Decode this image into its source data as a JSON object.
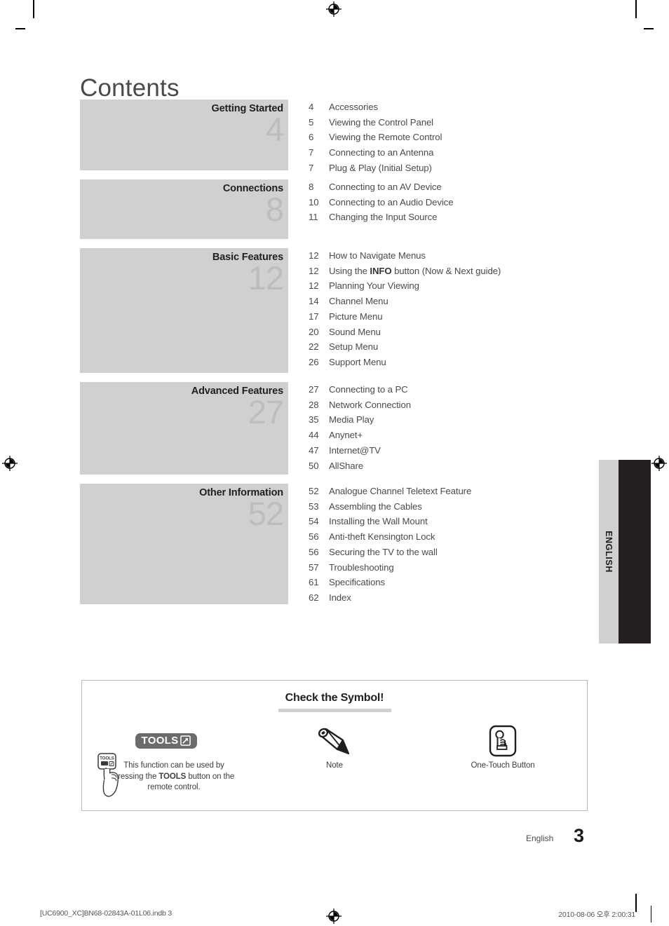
{
  "page": {
    "title": "Contents",
    "language_tab": "ENGLISH",
    "footer_language": "English",
    "footer_page_number": "3",
    "imprint_left": "[UC6900_XC]BN68-02843A-01L06.indb   3",
    "imprint_right": "2010-08-06   오후 2:00:31"
  },
  "colors": {
    "section_block_bg": "#cfd1d0",
    "section_number": "#bcbebd",
    "tab_bg": "#cfd1d0",
    "tab_black": "#231f20",
    "tools_badge_bg": "#6b6b6b",
    "body_text": "#4b4b4b",
    "title_text": "#1f1f1f"
  },
  "toc": {
    "sections": [
      {
        "title": "Getting Started",
        "number": "4",
        "block_height": 101,
        "entries": [
          {
            "page": "4",
            "name": "Accessories"
          },
          {
            "page": "5",
            "name": "Viewing the Control Panel"
          },
          {
            "page": "6",
            "name": "Viewing the Remote Control"
          },
          {
            "page": "7",
            "name": "Connecting to an Antenna"
          },
          {
            "page": "7",
            "name": "Plug & Play (Initial Setup)"
          }
        ]
      },
      {
        "title": "Connections",
        "number": "8",
        "block_height": 85,
        "entries": [
          {
            "page": "8",
            "name": "Connecting to an AV Device"
          },
          {
            "page": "10",
            "name": "Connecting to an Audio Device"
          },
          {
            "page": "11",
            "name": "Changing the Input Source"
          }
        ]
      },
      {
        "title": "Basic Features",
        "number": "12",
        "block_height": 178,
        "entries": [
          {
            "page": "12",
            "name": "How to Navigate Menus"
          },
          {
            "page": "12",
            "name_pre": "Using the ",
            "name_bold": "INFO",
            "name_post": " button (Now & Next guide)"
          },
          {
            "page": "12",
            "name": "Planning Your Viewing"
          },
          {
            "page": "14",
            "name": "Channel Menu"
          },
          {
            "page": "17",
            "name": "Picture Menu"
          },
          {
            "page": "20",
            "name": "Sound Menu"
          },
          {
            "page": "22",
            "name": "Setup Menu"
          },
          {
            "page": "26",
            "name": "Support Menu"
          }
        ]
      },
      {
        "title": "Advanced Features",
        "number": "27",
        "block_height": 132,
        "entries": [
          {
            "page": "27",
            "name": "Connecting to a PC"
          },
          {
            "page": "28",
            "name": "Network Connection"
          },
          {
            "page": "35",
            "name": "Media Play"
          },
          {
            "page": "44",
            "name": "Anynet+"
          },
          {
            "page": "47",
            "name": "Internet@TV"
          },
          {
            "page": "50",
            "name": "AllShare"
          }
        ]
      },
      {
        "title": "Other Information",
        "number": "52",
        "block_height": 172,
        "entries": [
          {
            "page": "52",
            "name": "Analogue Channel Teletext Feature"
          },
          {
            "page": "53",
            "name": "Assembling the Cables"
          },
          {
            "page": "54",
            "name": "Installing the Wall Mount"
          },
          {
            "page": "56",
            "name": "Anti-theft Kensington Lock"
          },
          {
            "page": "56",
            "name": "Securing the TV to the wall"
          },
          {
            "page": "57",
            "name": "Troubleshooting"
          },
          {
            "page": "61",
            "name": "Specifications"
          },
          {
            "page": "62",
            "name": "Index"
          }
        ]
      }
    ]
  },
  "symbol_box": {
    "title": "Check the Symbol!",
    "items": [
      {
        "icon": "tools-badge-icon",
        "badge_label": "TOOLS",
        "caption_line1": "This function can be used by",
        "caption_pre": "pressing the ",
        "caption_bold": "TOOLS",
        "caption_post": " button on the",
        "caption_line3": "remote control."
      },
      {
        "icon": "pencil-icon",
        "caption": "Note"
      },
      {
        "icon": "one-touch-button-icon",
        "caption": "One-Touch Button"
      }
    ]
  }
}
